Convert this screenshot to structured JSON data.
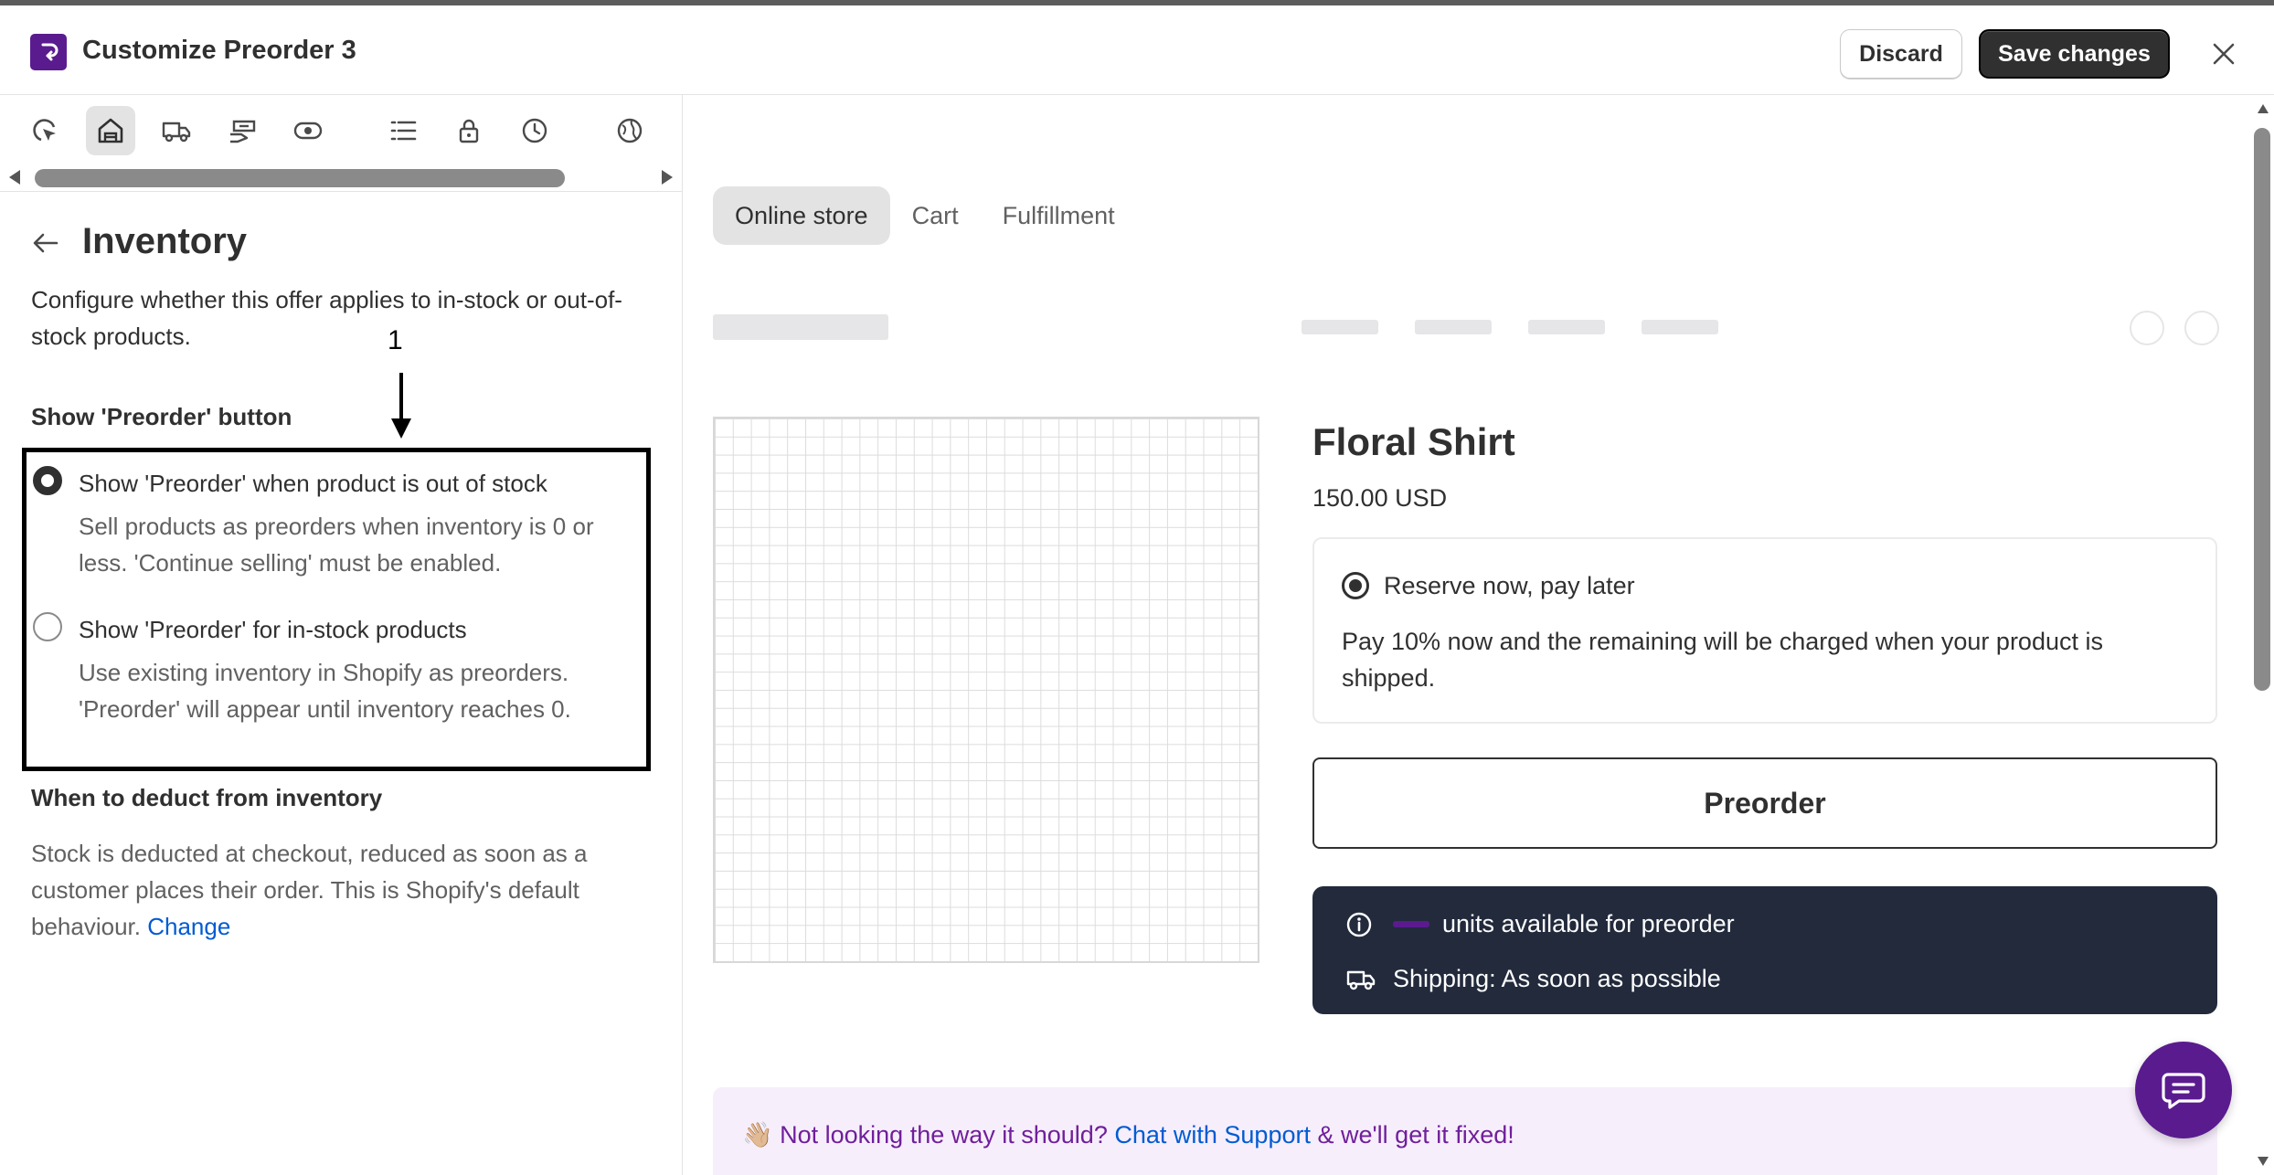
{
  "header": {
    "title": "Customize Preorder 3",
    "discard_label": "Discard",
    "save_label": "Save changes"
  },
  "left": {
    "tab_icons": [
      "cursor-click-icon",
      "store-icon",
      "delivery-truck-icon",
      "hand-payment-icon",
      "toggle-eye-icon",
      "list-icon",
      "lock-icon",
      "clock-icon",
      "globe-icon"
    ],
    "active_tab": "store-icon",
    "section_title": "Inventory",
    "section_desc": "Configure whether this offer applies to in-stock or out-of-stock products.",
    "annotation_number": "1",
    "group_label": "Show 'Preorder' button",
    "options": [
      {
        "label": "Show 'Preorder' when product is out of stock",
        "help": "Sell products as preorders when inventory is 0 or less. 'Continue selling' must be enabled.",
        "checked": true
      },
      {
        "label": "Show 'Preorder' for in-stock products",
        "help": "Use existing inventory in Shopify as preorders. 'Preorder' will appear until inventory reaches 0.",
        "checked": false
      }
    ],
    "deduct_label": "When to deduct from inventory",
    "deduct_text": "Stock is deducted at checkout, reduced as soon as a customer places their order. This is Shopify's default behaviour.",
    "deduct_link": "Change"
  },
  "preview": {
    "tabs": [
      "Online store",
      "Cart",
      "Fulfillment"
    ],
    "active_tab": "Online store",
    "product_title": "Floral Shirt",
    "product_price": "150.00 USD",
    "plan_label": "Reserve now, pay later",
    "plan_desc": "Pay 10% now and the remaining will be charged when your product is shipped.",
    "preorder_button": "Preorder",
    "units_text": "units available for preorder",
    "shipping_text": "Shipping: As soon as possible",
    "support_prefix": "👋🏼 Not looking the way it should?",
    "support_link": "Chat with Support",
    "support_suffix": "& we'll get it fixed!"
  },
  "colors": {
    "brand": "#5a1b8f",
    "dark": "#303030",
    "info_bg": "#222a3c",
    "link": "#005bd3",
    "support_bg": "#f7eefb"
  }
}
